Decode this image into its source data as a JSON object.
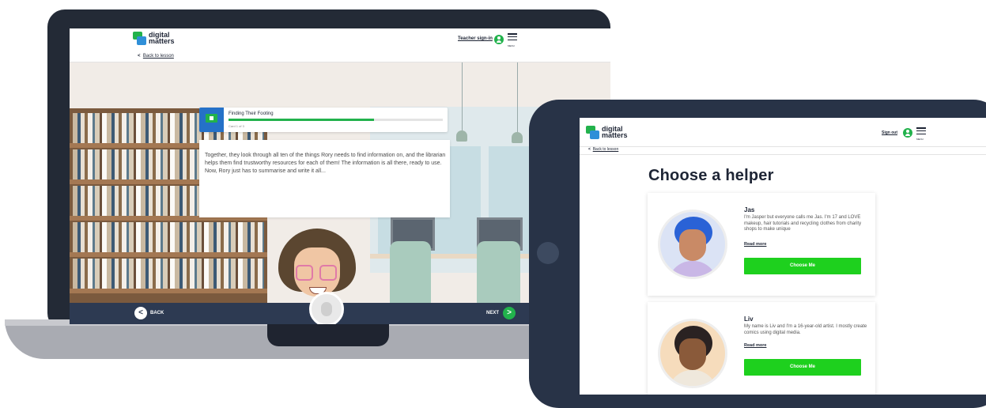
{
  "laptop": {
    "logo": {
      "line1": "digital",
      "line2": "matters"
    },
    "teacher_signin": "Teacher sign-in",
    "menu_label": "MENU",
    "back_to_lesson": "Back to lesson",
    "back_chevron": "<",
    "progress": {
      "title": "Finding Their Footing",
      "count": "Card 1 of 3",
      "fraction": 0.68
    },
    "speech_text": "Together, they look through all ten of the things Rory needs to find information on, and the librarian helps them find trustworthy resources for each of them! The information is all there, ready to use. Now, Rory just has to summarise and write it all...",
    "footer": {
      "back_label": "BACK",
      "next_label": "NEXT",
      "back_icon": "<",
      "next_icon": ">"
    }
  },
  "tablet": {
    "logo": {
      "line1": "digital",
      "line2": "matters"
    },
    "sign_out": "Sign out",
    "menu_label": "MENU",
    "back_to_lesson": "Back to lesson",
    "back_chevron": "<",
    "title": "Choose a helper",
    "helpers": [
      {
        "name": "Jas",
        "description": "I'm Jasper but everyone calls me Jas. I'm 17 and LOVE makeup, hair tutorials and recycling clothes from charity shops to make unique",
        "read_more": "Read more",
        "button": "Choose Me"
      },
      {
        "name": "Liv",
        "description": "My name is Liv and I'm a 16-year-old artist. I mostly create comics using digital media.",
        "read_more": "Read more",
        "button": "Choose Me"
      }
    ]
  },
  "colors": {
    "accent_green": "#22b24c",
    "button_green": "#1ed01e",
    "navy": "#2d3a52",
    "blue": "#2571c8"
  }
}
